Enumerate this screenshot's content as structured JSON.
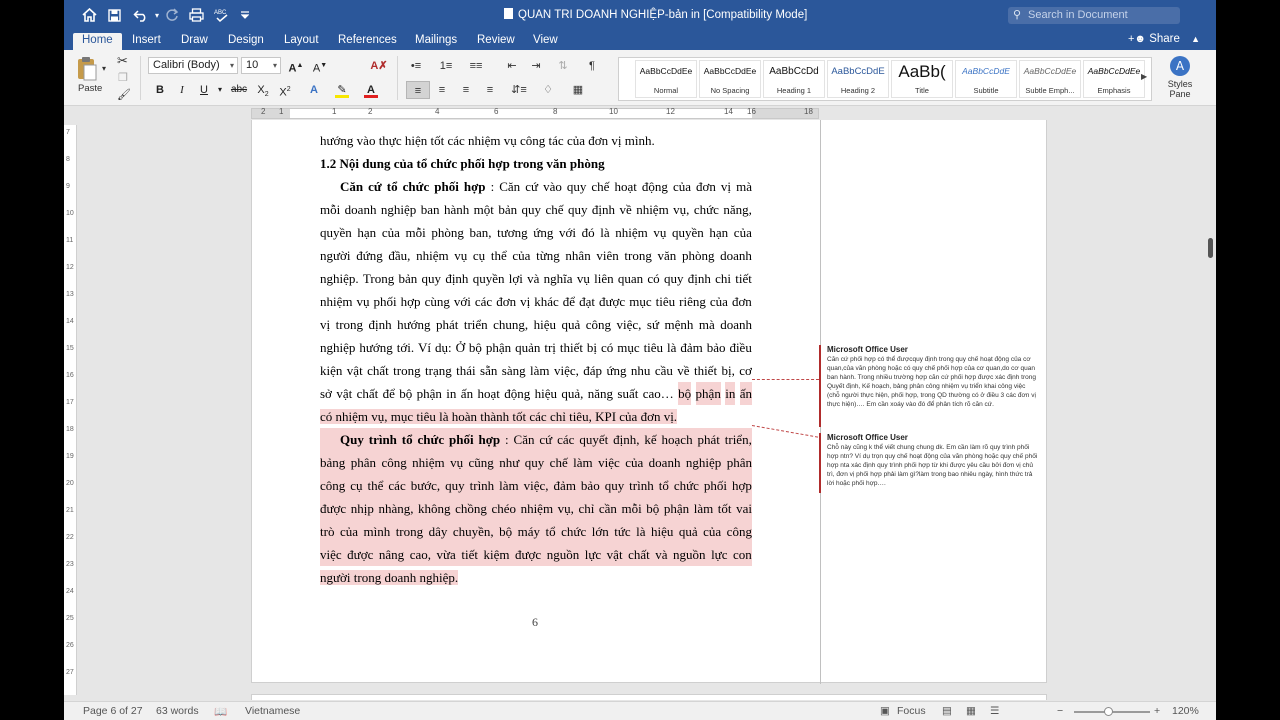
{
  "title_bar": {
    "doc_title": "QUAN TRI DOANH NGHIỆP-bản in [Compatibility Mode]",
    "search_placeholder": "Search in Document"
  },
  "tabs": [
    {
      "label": "Home",
      "active": true
    },
    {
      "label": "Insert"
    },
    {
      "label": "Draw"
    },
    {
      "label": "Design"
    },
    {
      "label": "Layout"
    },
    {
      "label": "References"
    },
    {
      "label": "Mailings"
    },
    {
      "label": "Review"
    },
    {
      "label": "View"
    }
  ],
  "share_label": "Share",
  "ribbon": {
    "paste_label": "Paste",
    "font_name": "Calibri (Body)",
    "font_size": "10",
    "styles": [
      {
        "preview": "AaBbCcDdEe",
        "name": "Normal"
      },
      {
        "preview": "AaBbCcDdEe",
        "name": "No Spacing"
      },
      {
        "preview": "AaBbCcDd",
        "name": "Heading 1"
      },
      {
        "preview": "AaBbCcDdE",
        "name": "Heading 2"
      },
      {
        "preview": "AaBb(",
        "name": "Title"
      },
      {
        "preview": "AaBbCcDdE",
        "name": "Subtitle"
      },
      {
        "preview": "AaBbCcDdEe",
        "name": "Subtle Emph..."
      },
      {
        "preview": "AaBbCcDdEe",
        "name": "Emphasis"
      }
    ],
    "styles_pane_label": "Styles Pane",
    "colors": {
      "highlight": "#f7e700",
      "font_color": "#e02020",
      "accent": "#2b579a"
    }
  },
  "ruler": {
    "h_numbers": [
      "2",
      "1",
      "1",
      "2",
      "4",
      "6",
      "8",
      "10",
      "12",
      "14",
      "16",
      "18"
    ],
    "v_numbers": [
      "7",
      "8",
      "9",
      "10",
      "11",
      "12",
      "13",
      "14",
      "15",
      "16",
      "17",
      "18",
      "19",
      "20",
      "21",
      "22",
      "23",
      "24",
      "25",
      "26",
      "27"
    ]
  },
  "document": {
    "lines": [
      {
        "segs": [
          {
            "t": "hướng vào thực hiện tốt các nhiệm vụ công tác của đơn vị mình."
          }
        ]
      },
      {
        "segs": [
          {
            "t": "1.2 Nội dung của tổ chức phối hợp trong văn phòng",
            "b": true
          }
        ]
      },
      {
        "segs": [
          {
            "t": "Căn cứ tổ chức phối hợp",
            "b": true
          },
          {
            "t": ": Căn cứ vào quy chế hoạt động của đơn vị mà"
          }
        ],
        "indent": true,
        "j": true
      },
      {
        "segs": [
          {
            "t": "mỗi doanh nghiệp ban hành một bản quy chế quy định về nhiệm vụ, chức năng,"
          }
        ],
        "j": true
      },
      {
        "segs": [
          {
            "t": "quyền hạn của mỗi phòng ban, tương ứng với đó là nhiệm vụ quyền hạn của"
          }
        ],
        "j": true
      },
      {
        "segs": [
          {
            "t": "người đứng đầu, nhiệm vụ cụ thể của từng nhân viên trong văn phòng doanh"
          }
        ],
        "j": true
      },
      {
        "segs": [
          {
            "t": "nghiệp. Trong bản quy định quyền lợi và nghĩa vụ liên quan có quy định chi tiết"
          }
        ],
        "j": true
      },
      {
        "segs": [
          {
            "t": "nhiệm vụ phối hợp cùng với các đơn vị khác để đạt được mục tiêu riêng của đơn"
          }
        ],
        "j": true
      },
      {
        "segs": [
          {
            "t": "vị trong định hướng phát triển chung, hiệu quả công việc, sứ mệnh mà doanh"
          }
        ],
        "j": true
      },
      {
        "segs": [
          {
            "t": "nghiệp hướng tới. Ví dụ: Ở bộ phận quản trị thiết bị có mục tiêu là đảm bảo điều"
          }
        ],
        "j": true
      },
      {
        "segs": [
          {
            "t": "kiện vật chất trong trạng thái sẵn sàng làm việc, đáp ứng nhu cầu về thiết bị, cơ"
          }
        ],
        "j": true
      },
      {
        "segs": [
          {
            "t": "sở vật chất để bộ phận in ấn hoạt động hiệu quả, năng suất cao…"
          },
          {
            "t": "bộ phận in ấn",
            "hl": true
          }
        ],
        "j": true
      },
      {
        "segs": [
          {
            "t": "có nhiệm vụ, mục tiêu là hoàn thành tốt các chỉ tiêu, KPI của đơn vị.",
            "hl": true
          }
        ]
      },
      {
        "segs": [
          {
            "t": "Quy trình tổ chức phối hợp",
            "b": true,
            "hl": true
          },
          {
            "t": ": Căn cứ các quyết định, kế hoạch phát triển,",
            "hl": true
          }
        ],
        "indent": true,
        "j": true,
        "hl": true
      },
      {
        "segs": [
          {
            "t": "bảng phân công nhiệm vụ cũng như quy chế làm việc của doanh nghiệp phân",
            "hl": true
          }
        ],
        "j": true,
        "hl": true
      },
      {
        "segs": [
          {
            "t": "công cụ thể các bước, quy trình làm việc, đảm bảo quy trình tổ chức phối hợp",
            "hl": true
          }
        ],
        "j": true,
        "hl": true
      },
      {
        "segs": [
          {
            "t": "được nhịp nhàng, không chồng chéo nhiệm vụ, chỉ cần mỗi bộ phận làm tốt vai",
            "hl": true
          }
        ],
        "j": true,
        "hl": true
      },
      {
        "segs": [
          {
            "t": "trò của mình trong dây chuyền, bộ máy tổ chức lớn tức là hiệu quả của công",
            "hl": true
          }
        ],
        "j": true,
        "hl": true
      },
      {
        "segs": [
          {
            "t": "việc được nâng cao, vừa tiết kiệm được nguồn lực vật chất và nguồn lực con",
            "hl": true
          }
        ],
        "j": true,
        "hl": true
      },
      {
        "segs": [
          {
            "t": "người trong doanh nghiệp.",
            "hl": true
          }
        ]
      }
    ],
    "page_number": "6"
  },
  "comments": [
    {
      "author": "Microsoft Office User",
      "text": "Căn cứ phối hợp có thể đượcquy định trong quy chế hoạt động của cơ quan,của văn phòng hoặc có quy chế phối hợp của cơ quan,do cơ quan ban hành. Trong nhiều trường hợp căn cứ phối hợp được xác định trong Quyết định, Kế hoạch, bảng phân công nhiệm vụ triển khai công việc (chỗ người thực hiện, phối hợp, trong QD thường có ở điều 3 các đơn vị thực hiện)…. Em cần xoáy vào đó để phân tích rõ căn cứ."
    },
    {
      "author": "Microsoft Office User",
      "text": "Chỗ này cũng k thể viết chung chung dk. Em cần làm rõ quy trình phối hợp ntn? Ví dụ trọn quy chế hoạt động của văn phòng hoặc quy chế phối hợp nta xác định quy trình phối hợp từ khi được yêu cầu bởi đơn vị chủ trì, đơn vị phối hợp phải làm gì?làm trong bao nhiêu ngày, hình thức trả lời hoặc phối hợp…."
    }
  ],
  "status_bar": {
    "page_info": "Page 6 of 27",
    "word_count": "63 words",
    "language": "Vietnamese",
    "focus_label": "Focus",
    "zoom": "120%"
  }
}
